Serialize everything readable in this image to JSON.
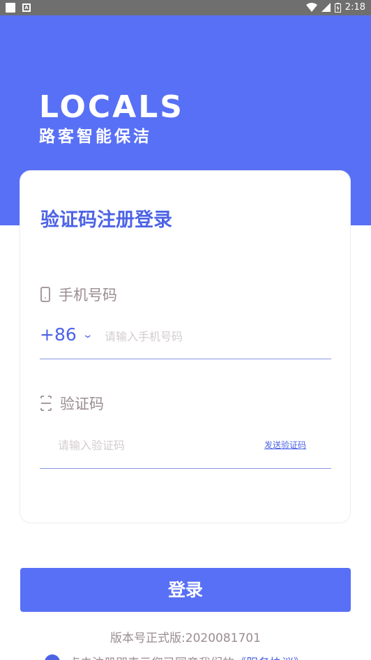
{
  "status_bar": {
    "time": "2:18"
  },
  "brand": {
    "name_en": "LOCALS",
    "name_cn": "路客智能保洁"
  },
  "form": {
    "title": "验证码注册登录",
    "phone_label": "手机号码",
    "country_code": "+86",
    "phone_placeholder": "请输入手机号码",
    "code_label": "验证码",
    "code_placeholder": "请输入验证码",
    "send_code": "发送验证码"
  },
  "login_button": "登录",
  "version": "版本号正式版:2020081701",
  "agreement": {
    "prefix": "点击注册即表示您已同意我们的",
    "link": "《服务协议》"
  },
  "colors": {
    "primary": "#5870f5",
    "accent_text": "#4d63e6",
    "muted_text": "#9a8c92"
  }
}
